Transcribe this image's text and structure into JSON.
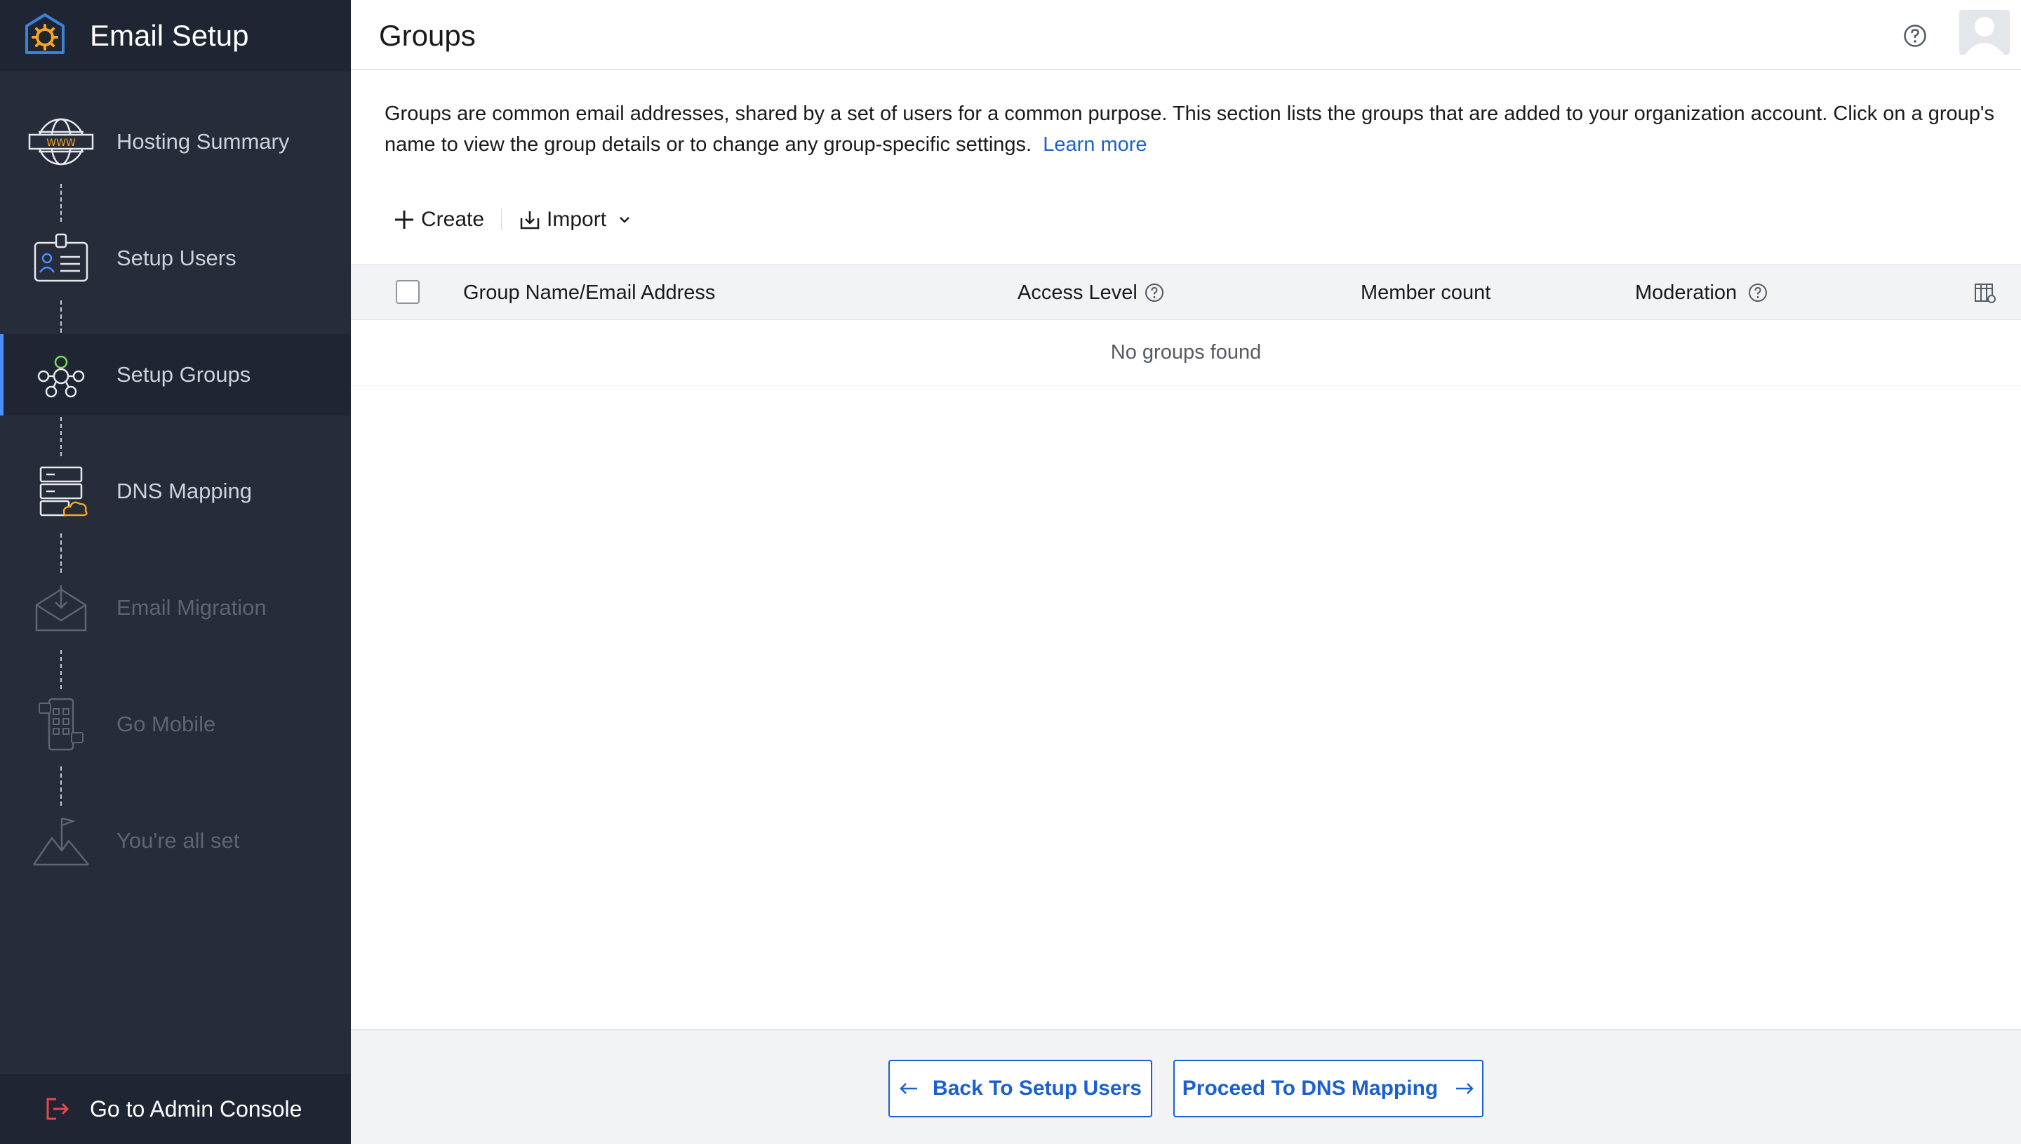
{
  "app": {
    "title": "Email Setup"
  },
  "sidebar": {
    "steps": [
      {
        "label": "Hosting Summary",
        "icon": "globe-www-icon",
        "state": "done"
      },
      {
        "label": "Setup Users",
        "icon": "id-badge-icon",
        "state": "done"
      },
      {
        "label": "Setup Groups",
        "icon": "group-network-icon",
        "state": "active"
      },
      {
        "label": "DNS Mapping",
        "icon": "server-cloud-icon",
        "state": "enabled"
      },
      {
        "label": "Email Migration",
        "icon": "envelope-download-icon",
        "state": "disabled"
      },
      {
        "label": "Go Mobile",
        "icon": "mobile-grid-icon",
        "state": "disabled"
      },
      {
        "label": "You're all set",
        "icon": "mountain-flag-icon",
        "state": "disabled"
      }
    ],
    "admin_console_label": "Go to Admin Console"
  },
  "header": {
    "title": "Groups"
  },
  "description": {
    "text": "Groups are common email addresses, shared by a set of users for a common purpose. This section lists the groups that are added to your organization account. Click on a group's name to view the group details or to change any group-specific settings.",
    "link": "Learn more"
  },
  "toolbar": {
    "create_label": "Create",
    "import_label": "Import"
  },
  "table": {
    "columns": [
      "Group Name/Email Address",
      "Access Level",
      "Member count",
      "Moderation"
    ],
    "empty_message": "No groups found"
  },
  "footer": {
    "back_label": "Back To Setup Users",
    "proceed_label": "Proceed To DNS Mapping"
  },
  "colors": {
    "sidebar_bg": "#262c3a",
    "accent_blue": "#1b5fd0",
    "active_indicator": "#4a90ff",
    "logo_orange": "#f5a623"
  }
}
